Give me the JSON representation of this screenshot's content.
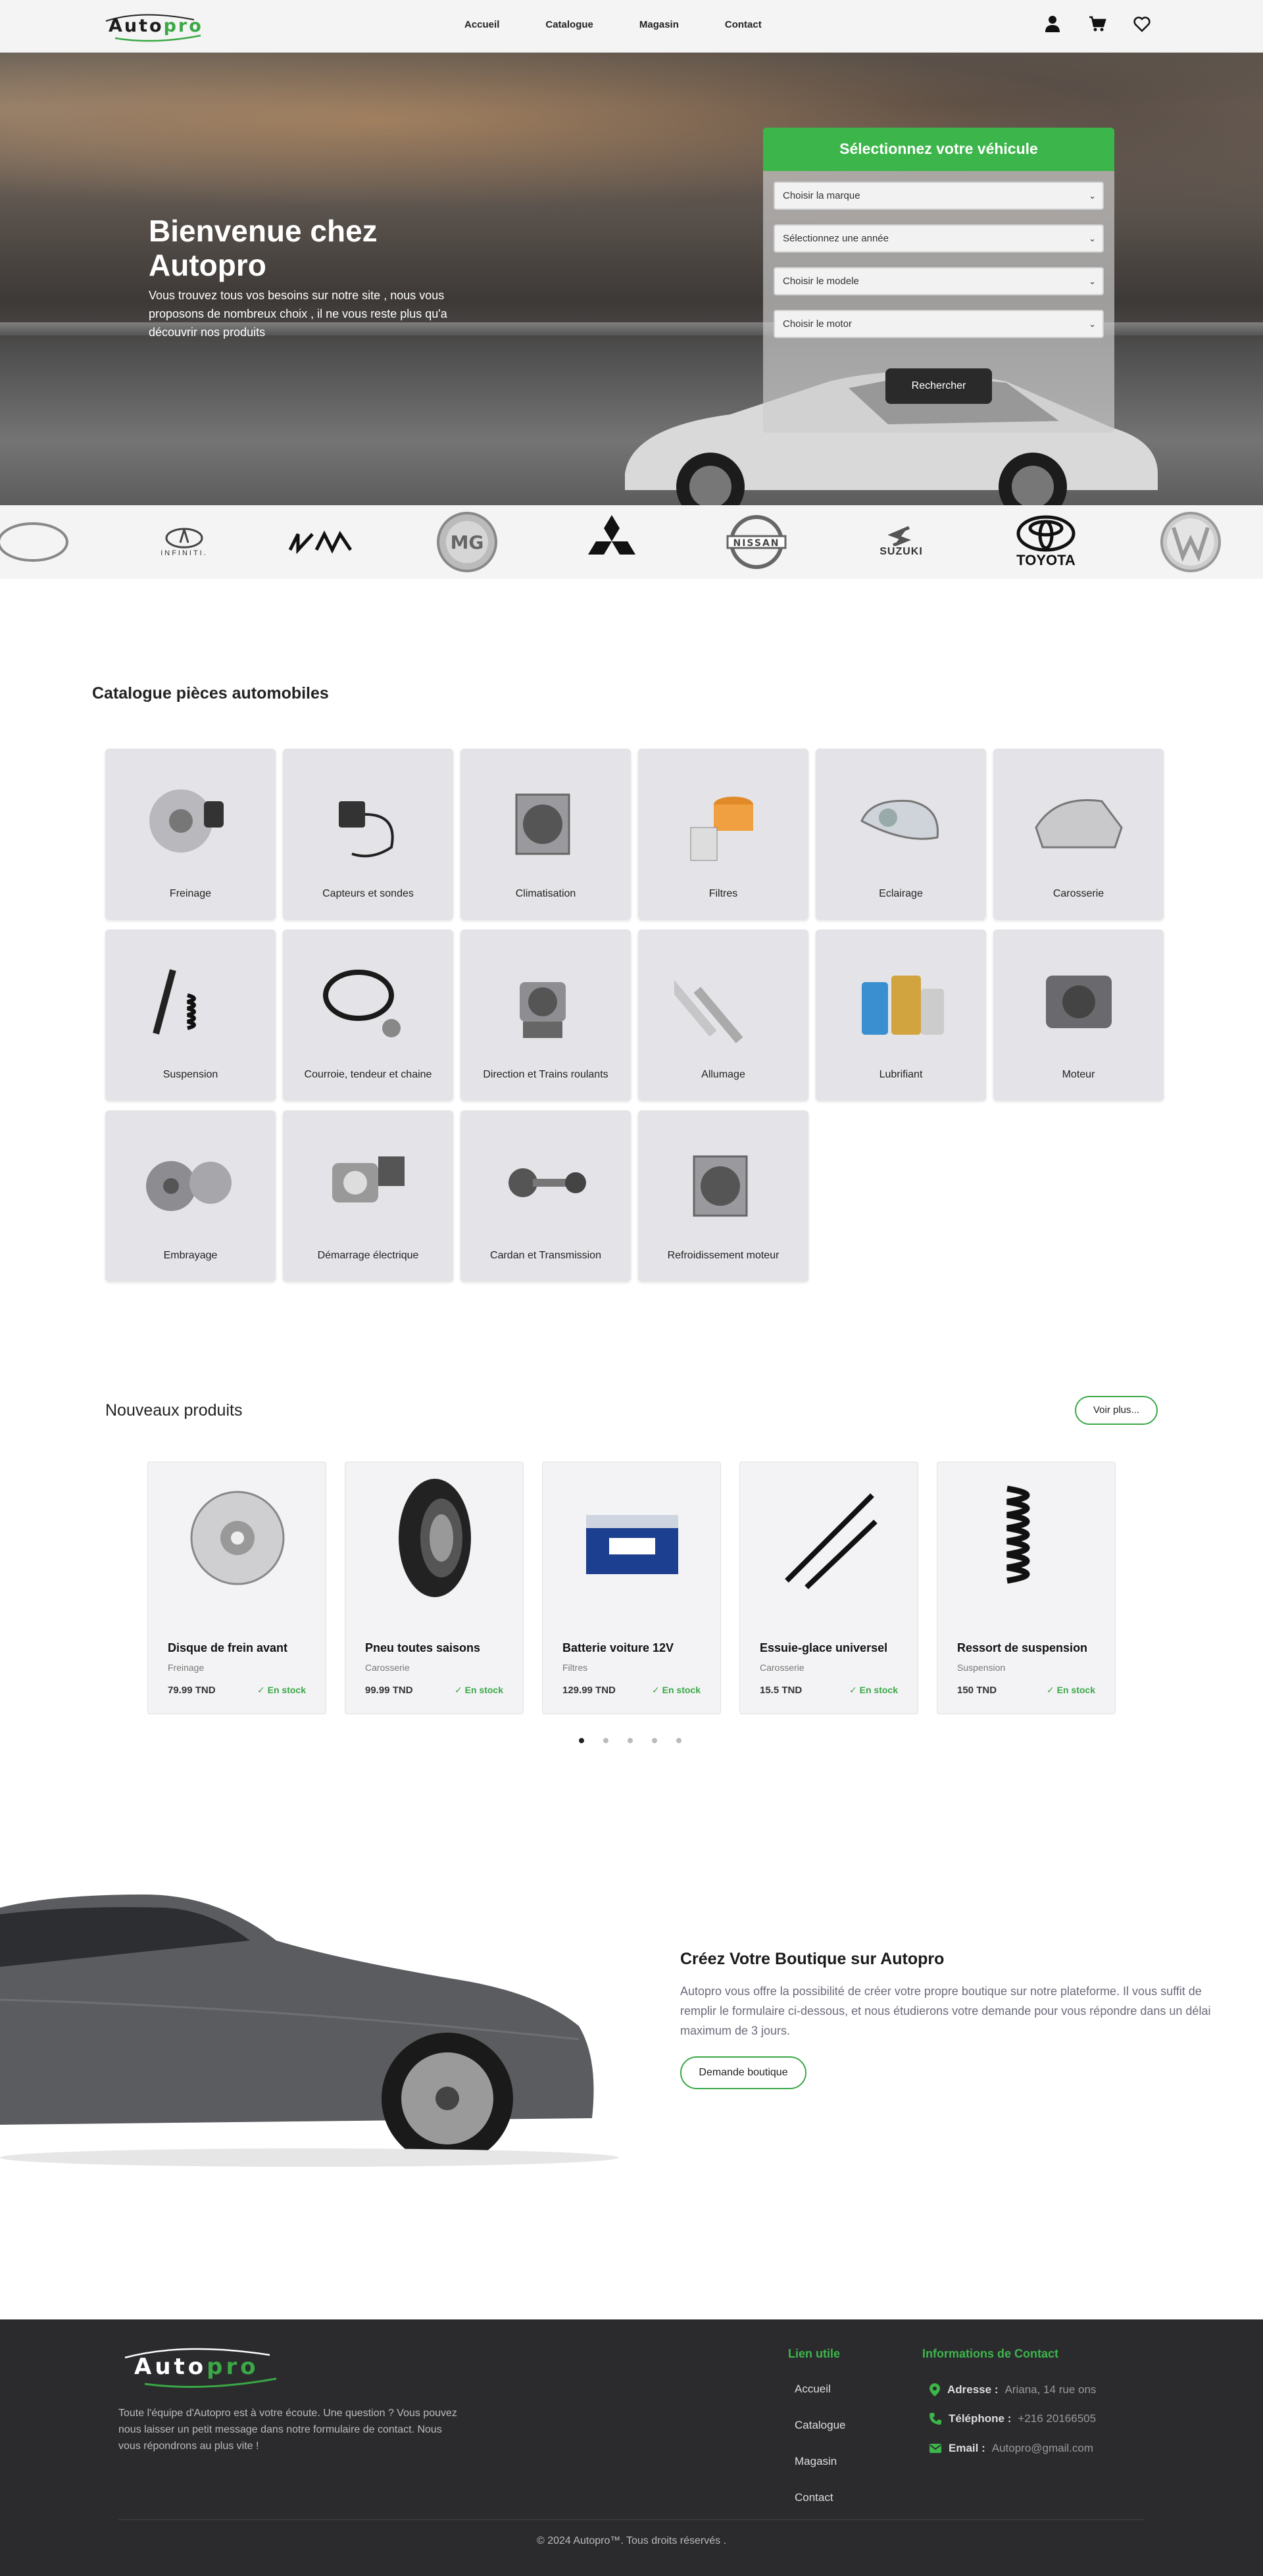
{
  "brand": {
    "logo_text_a": "Auto",
    "logo_text_b": "pro"
  },
  "nav": {
    "items": [
      "Accueil",
      "Catalogue",
      "Magasin",
      "Contact"
    ]
  },
  "hero": {
    "title": "Bienvenue chez Autopro",
    "text": "Vous trouvez tous vos besoins sur notre site , nous vous proposons de nombreux choix , il ne vous reste plus qu'a découvrir nos produits",
    "finder": {
      "title": "Sélectionnez votre véhicule",
      "selects": [
        "Choisir la marque",
        "Sélectionnez une année",
        "Choisir le modele",
        "Choisir le motor"
      ],
      "button": "Rechercher"
    }
  },
  "brands": [
    "BYD",
    "INFINITI.",
    "KIA",
    "MG",
    "MITSUBISHI",
    "NISSAN",
    "SUZUKI",
    "TOYOTA",
    "VW"
  ],
  "catalog": {
    "title": "Catalogue pièces automobiles",
    "items": [
      "Freinage",
      "Capteurs et sondes",
      "Climatisation",
      "Filtres",
      "Eclairage",
      "Carosserie",
      "Suspension",
      "Courroie, tendeur et chaine",
      "Direction et Trains roulants",
      "Allumage",
      "Lubrifiant",
      "Moteur",
      "Embrayage",
      "Démarrage électrique",
      "Cardan et Transmission",
      "Refroidissement moteur"
    ]
  },
  "new_products": {
    "title": "Nouveaux produits",
    "more": "Voir plus...",
    "items": [
      {
        "name": "Disque de frein avant",
        "category": "Freinage",
        "price": "79.99 TND",
        "stock": "En stock"
      },
      {
        "name": "Pneu toutes saisons",
        "category": "Carosserie",
        "price": "99.99 TND",
        "stock": "En stock"
      },
      {
        "name": "Batterie voiture 12V",
        "category": "Filtres",
        "price": "129.99 TND",
        "stock": "En stock"
      },
      {
        "name": "Essuie-glace universel",
        "category": "Carosserie",
        "price": "15.5 TND",
        "stock": "En stock"
      },
      {
        "name": "Ressort de suspension",
        "category": "Suspension",
        "price": "150 TND",
        "stock": "En stock"
      }
    ],
    "active_page": 1,
    "page_count": 5
  },
  "boutique": {
    "title": "Créez Votre Boutique sur Autopro",
    "text": "Autopro vous offre la possibilité de créer votre propre boutique sur notre plateforme. Il vous suffit de remplir le formulaire ci-dessous, et nous étudierons votre demande pour vous répondre dans un délai maximum de 3 jours.",
    "button": "Demande boutique"
  },
  "footer": {
    "desc": "Toute l'équipe d'Autopro est à votre écoute. Une question ? Vous pouvez nous laisser un petit message dans notre formulaire de contact. Nous vous répondrons au plus vite !",
    "links_title": "Lien utile",
    "links": [
      "Accueil",
      "Catalogue",
      "Magasin",
      "Contact"
    ],
    "contact_title": "Informations de Contact",
    "address_label": "Adresse :",
    "address": "Ariana, 14 rue ons",
    "phone_label": "Téléphone :",
    "phone": "+216 20166505",
    "email_label": "Email :",
    "email": "Autopro@gmail.com",
    "copyright": "© 2024 Autopro™. Tous droits réservés ."
  },
  "colors": {
    "accent": "#3cb54a",
    "dark": "#2b2b2e"
  }
}
